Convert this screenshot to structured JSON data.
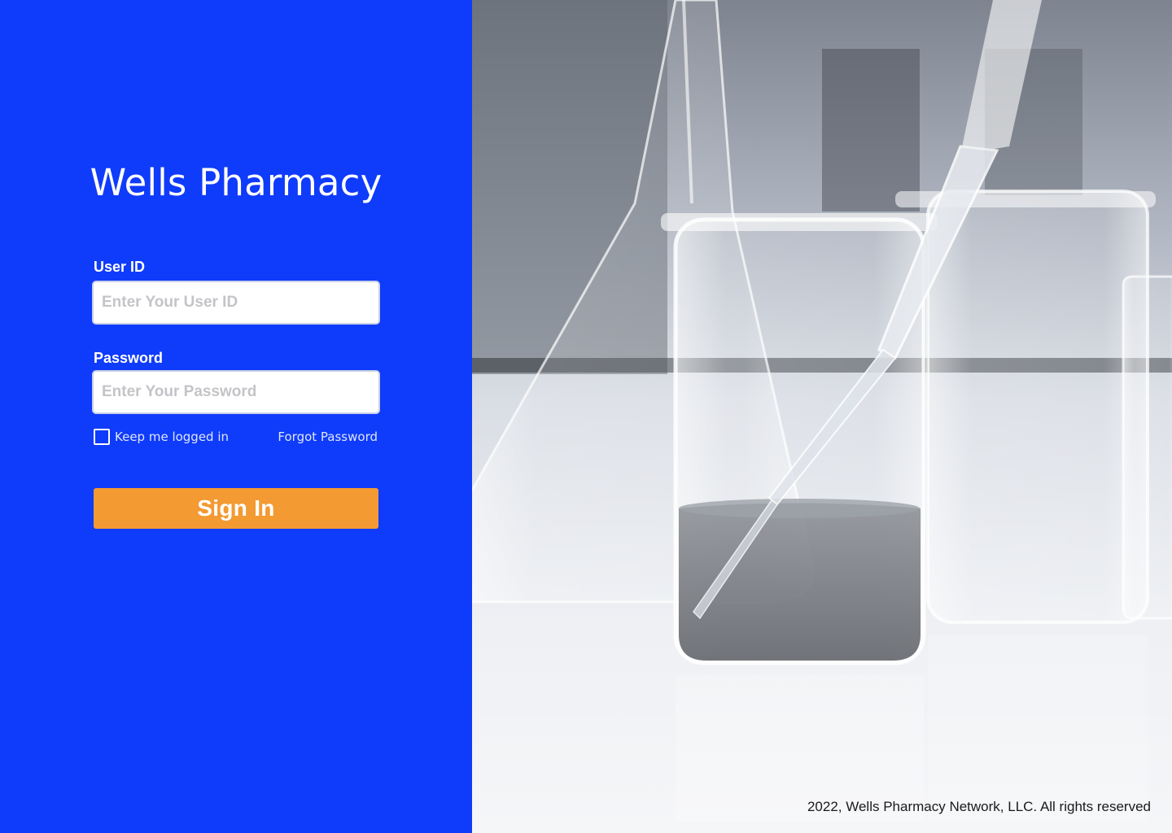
{
  "brand": {
    "title": "Wells Pharmacy"
  },
  "form": {
    "user_id_label": "User ID",
    "user_id_placeholder": "Enter Your User ID",
    "password_label": "Password",
    "password_placeholder": "Enter Your Password",
    "keep_logged_in_label": "Keep me logged in",
    "keep_logged_in_checked": false,
    "forgot_password_label": "Forgot Password",
    "sign_in_label": "Sign In"
  },
  "hero": {
    "image_icon": "lab-glassware-photo",
    "copyright": "2022, Wells Pharmacy Network, LLC. All rights reserved"
  },
  "colors": {
    "panel_blue": "#0f3bfb",
    "button_orange": "#f39a32"
  }
}
